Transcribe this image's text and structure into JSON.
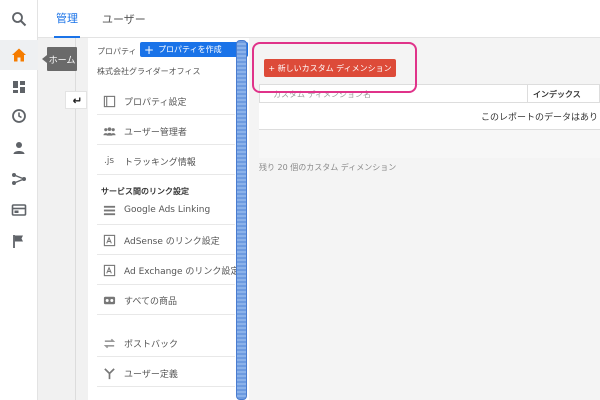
{
  "tabs": [
    {
      "label": "管理",
      "active": true
    },
    {
      "label": "ユーザー",
      "active": false
    }
  ],
  "tooltip": "ホーム",
  "property": {
    "label": "プロパティ",
    "create_button": "プロパティを作成",
    "company": "株式会社グライダーオフィス"
  },
  "menu": [
    {
      "label": "プロパティ設定",
      "icon": "property-settings-icon"
    },
    {
      "label": "ユーザー管理者",
      "icon": "users-icon"
    },
    {
      "label": "トラッキング情報",
      "icon": "js-icon"
    }
  ],
  "section_label": "サービス間のリンク設定",
  "links": [
    {
      "label": "Google Ads Linking",
      "icon": "google-ads-icon"
    },
    {
      "label": "AdSense のリンク設定",
      "icon": "adsense-icon"
    },
    {
      "label": "Ad Exchange のリンク設定",
      "icon": "adexchange-icon"
    },
    {
      "label": "すべての商品",
      "icon": "products-icon"
    }
  ],
  "extra": [
    {
      "label": "ポストバック",
      "icon": "postback-icon"
    },
    {
      "label": "ユーザー定義",
      "icon": "user-definition-icon"
    }
  ],
  "js_glyph": ".js",
  "main": {
    "new_dimension_button": "+ 新しいカスタム ディメンション",
    "table_headers": [
      "カスタム ディメンション名",
      "インデックス"
    ],
    "empty_message": "このレポートのデータはあり",
    "remaining": "残り 20 個のカスタム ディメンション"
  },
  "colors": {
    "accent": "#1a73e8",
    "active_nav": "#f57c00",
    "new_button": "#dd4b39",
    "highlight": "#e0338a"
  }
}
